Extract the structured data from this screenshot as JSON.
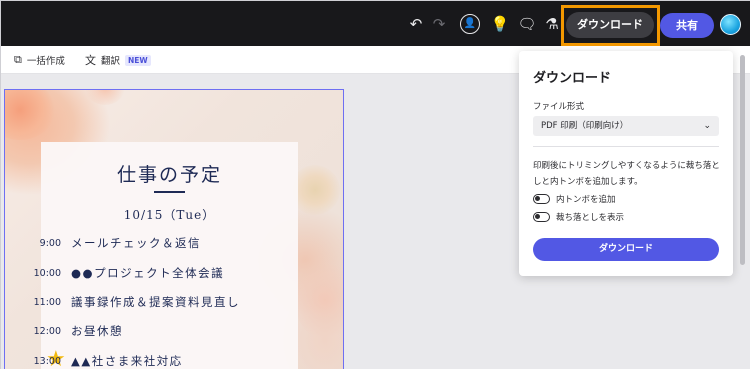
{
  "topbar": {
    "icons": [
      "undo-icon",
      "redo-icon",
      "add-user-icon",
      "idea-icon",
      "comment-icon",
      "flask-icon"
    ],
    "download_label": "ダウンロード",
    "share_label": "共有"
  },
  "subbar": {
    "bulk_create_label": "一括作成",
    "translate_label": "翻訳",
    "translate_badge": "NEW"
  },
  "design": {
    "title": "仕事の予定",
    "date": "10/15（Tue）",
    "schedule": [
      {
        "time": "9:00",
        "text": "メールチェック＆返信"
      },
      {
        "time": "10:00",
        "text": "●●プロジェクト全体会議"
      },
      {
        "time": "11:00",
        "text": "議事録作成＆提案資料見直し"
      },
      {
        "time": "12:00",
        "text": "お昼休憩"
      },
      {
        "time": "13:00",
        "text": "▲▲社さま来社対応"
      }
    ]
  },
  "download_panel": {
    "title": "ダウンロード",
    "file_format_label": "ファイル形式",
    "file_format_value": "PDF 印刷（印刷向け）",
    "description": "印刷後にトリミングしやすくなるように裁ち落としと内トンボを追加します。",
    "option_crop_marks": "内トンボを追加",
    "option_bleed": "裁ち落としを表示",
    "download_button": "ダウンロード"
  },
  "colors": {
    "accent": "#5258e4",
    "highlight": "#f39800",
    "topbar": "#18181b",
    "navy": "#1e2a55"
  }
}
